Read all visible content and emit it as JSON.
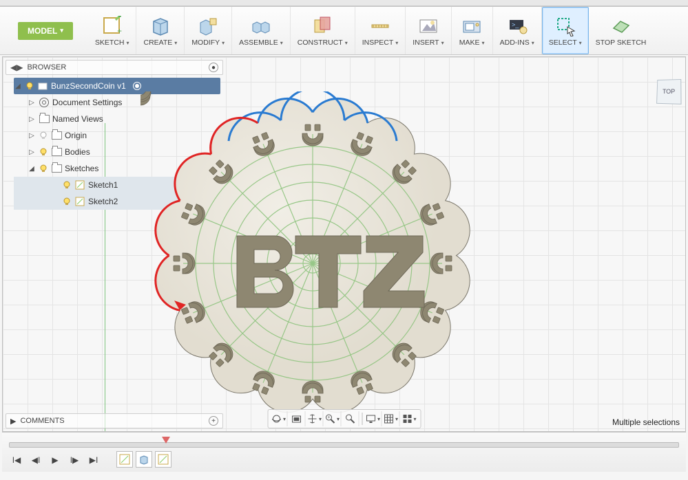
{
  "app": {
    "workspace_mode": "MODEL"
  },
  "ribbon": {
    "sketch": {
      "label": "SKETCH",
      "has_dropdown": true
    },
    "create": {
      "label": "CREATE",
      "has_dropdown": true
    },
    "modify": {
      "label": "MODIFY",
      "has_dropdown": true
    },
    "assemble": {
      "label": "ASSEMBLE",
      "has_dropdown": true
    },
    "construct": {
      "label": "CONSTRUCT",
      "has_dropdown": true
    },
    "inspect": {
      "label": "INSPECT",
      "has_dropdown": true
    },
    "insert": {
      "label": "INSERT",
      "has_dropdown": true
    },
    "make": {
      "label": "MAKE",
      "has_dropdown": true
    },
    "addins": {
      "label": "ADD-INS",
      "has_dropdown": true
    },
    "select": {
      "label": "SELECT",
      "has_dropdown": true,
      "active": true
    },
    "stop_sketch": {
      "label": "STOP SKETCH",
      "has_dropdown": false
    }
  },
  "browser": {
    "title": "BROWSER",
    "root": {
      "label": "BunzSecondCoin v1"
    },
    "doc_settings": {
      "label": "Document Settings"
    },
    "named_views": {
      "label": "Named Views"
    },
    "origin": {
      "label": "Origin"
    },
    "bodies": {
      "label": "Bodies"
    },
    "sketches": {
      "label": "Sketches"
    },
    "sketch1": {
      "label": "Sketch1"
    },
    "sketch2": {
      "label": "Sketch2"
    }
  },
  "viewcube": {
    "face": "TOP"
  },
  "canvas": {
    "center_text": "BTZ",
    "scallops": 16,
    "annotations": {
      "blue_arcs_color": "#2a7bd1",
      "red_arcs_color": "#e02424"
    }
  },
  "comments": {
    "title": "COMMENTS"
  },
  "status": {
    "text": "Multiple selections"
  },
  "timeline": {
    "controls": [
      "first",
      "prev",
      "play",
      "next",
      "last"
    ]
  }
}
